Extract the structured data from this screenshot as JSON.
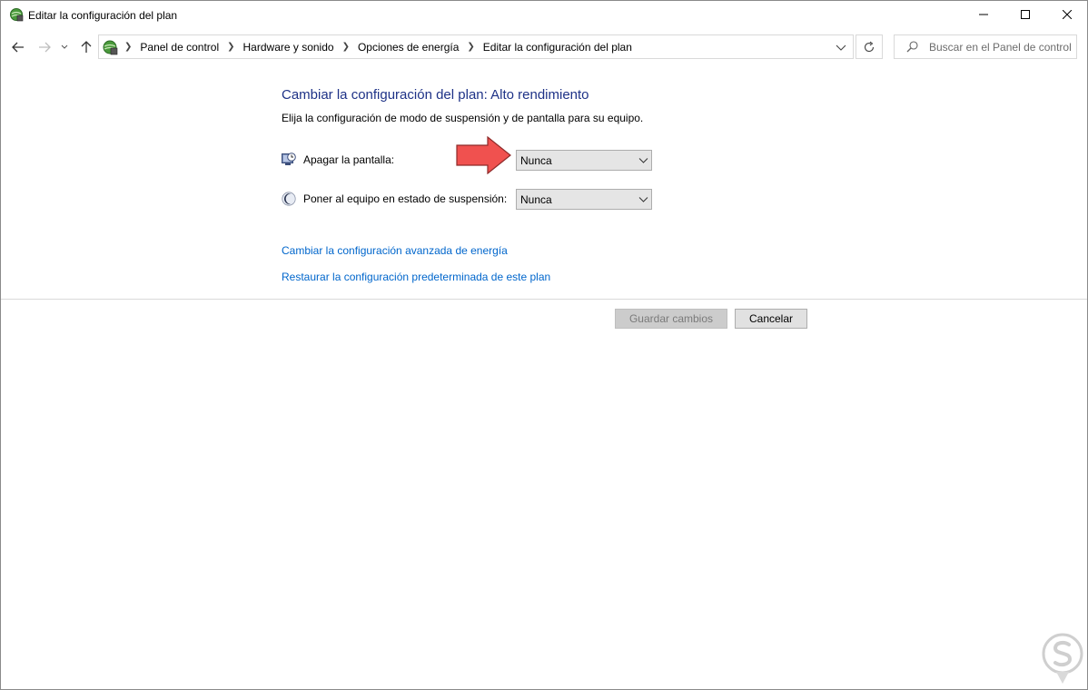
{
  "window": {
    "title": "Editar la configuración del plan"
  },
  "nav": {
    "breadcrumbs": [
      "Panel de control",
      "Hardware y sonido",
      "Opciones de energía",
      "Editar la configuración del plan"
    ],
    "search_placeholder": "Buscar en el Panel de control"
  },
  "main": {
    "title": "Cambiar la configuración del plan: Alto rendimiento",
    "description": "Elija la configuración de modo de suspensión y de pantalla para su equipo.",
    "display_off": {
      "label": "Apagar la pantalla:",
      "value": "Nunca"
    },
    "sleep": {
      "label": "Poner al equipo en estado de suspensión:",
      "value": "Nunca"
    },
    "links": {
      "advanced": "Cambiar la configuración avanzada de energía",
      "restore": "Restaurar la configuración predeterminada de este plan"
    }
  },
  "buttons": {
    "save": "Guardar cambios",
    "cancel": "Cancelar"
  },
  "colors": {
    "title_blue": "#1e3287",
    "link_blue": "#0066cc",
    "annotation_red": "#f0514f"
  }
}
